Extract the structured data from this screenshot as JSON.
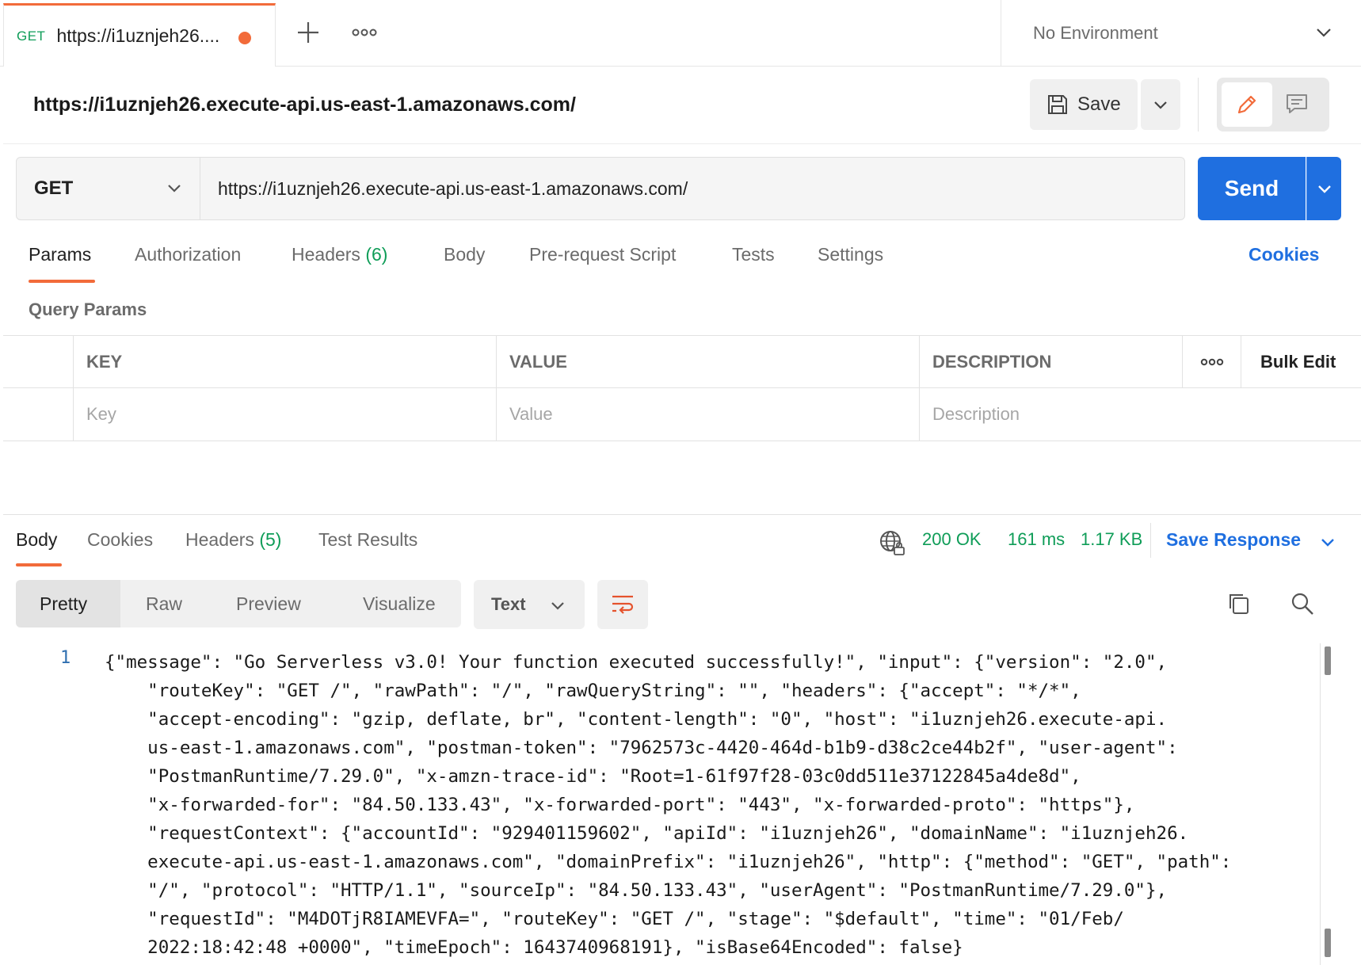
{
  "tabbar": {
    "tab": {
      "method": "GET",
      "title": "https://i1uznjeh26...."
    },
    "environment": "No Environment"
  },
  "request": {
    "name": "https://i1uznjeh26.execute-api.us-east-1.amazonaws.com/",
    "save_label": "Save",
    "method": "GET",
    "url": "https://i1uznjeh26.execute-api.us-east-1.amazonaws.com/",
    "send_label": "Send"
  },
  "request_tabs": [
    {
      "label": "Params"
    },
    {
      "label": "Authorization"
    },
    {
      "label": "Headers",
      "count": "(6)"
    },
    {
      "label": "Body"
    },
    {
      "label": "Pre-request Script"
    },
    {
      "label": "Tests"
    },
    {
      "label": "Settings"
    }
  ],
  "cookies_link": "Cookies",
  "query_params": {
    "title": "Query Params",
    "columns": [
      "KEY",
      "VALUE",
      "DESCRIPTION"
    ],
    "bulk_edit": "Bulk Edit",
    "placeholders": [
      "Key",
      "Value",
      "Description"
    ]
  },
  "response": {
    "tabs": [
      {
        "label": "Body"
      },
      {
        "label": "Cookies"
      },
      {
        "label": "Headers",
        "count": "(5)"
      },
      {
        "label": "Test Results"
      }
    ],
    "status": "200 OK",
    "time": "161 ms",
    "size": "1.17 KB",
    "save_response": "Save Response",
    "views": [
      "Pretty",
      "Raw",
      "Preview",
      "Visualize"
    ],
    "format": "Text",
    "line_number": "1",
    "body_lines": [
      "{\"message\": \"Go Serverless v3.0! Your function executed successfully!\", \"input\": {\"version\": \"2.0\",",
      "    \"routeKey\": \"GET /\", \"rawPath\": \"/\", \"rawQueryString\": \"\", \"headers\": {\"accept\": \"*/*\",",
      "    \"accept-encoding\": \"gzip, deflate, br\", \"content-length\": \"0\", \"host\": \"i1uznjeh26.execute-api.",
      "    us-east-1.amazonaws.com\", \"postman-token\": \"7962573c-4420-464d-b1b9-d38c2ce44b2f\", \"user-agent\":",
      "    \"PostmanRuntime/7.29.0\", \"x-amzn-trace-id\": \"Root=1-61f97f28-03c0dd511e37122845a4de8d\",",
      "    \"x-forwarded-for\": \"84.50.133.43\", \"x-forwarded-port\": \"443\", \"x-forwarded-proto\": \"https\"},",
      "    \"requestContext\": {\"accountId\": \"929401159602\", \"apiId\": \"i1uznjeh26\", \"domainName\": \"i1uznjeh26.",
      "    execute-api.us-east-1.amazonaws.com\", \"domainPrefix\": \"i1uznjeh26\", \"http\": {\"method\": \"GET\", \"path\":",
      "    \"/\", \"protocol\": \"HTTP/1.1\", \"sourceIp\": \"84.50.133.43\", \"userAgent\": \"PostmanRuntime/7.29.0\"},",
      "    \"requestId\": \"M4DOTjR8IAMEVFA=\", \"routeKey\": \"GET /\", \"stage\": \"$default\", \"time\": \"01/Feb/",
      "    2022:18:42:48 +0000\", \"timeEpoch\": 1643740968191}, \"isBase64Encoded\": false}"
    ]
  },
  "colors": {
    "accent": "#f26b3a",
    "primary": "#1f6fe0",
    "success": "#0f9d58"
  }
}
